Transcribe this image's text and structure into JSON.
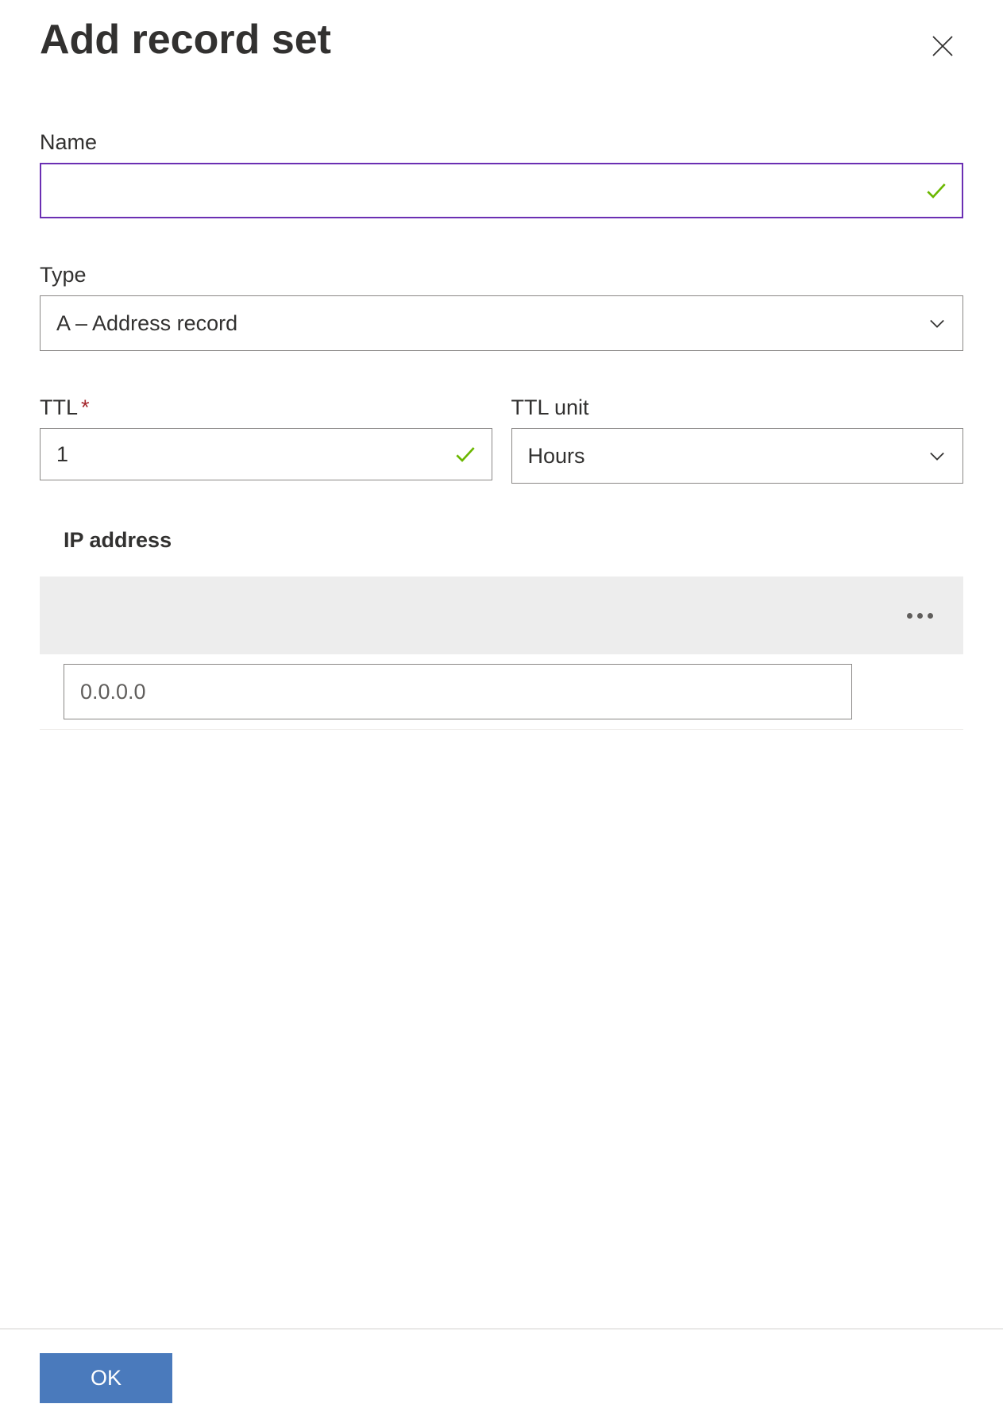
{
  "header": {
    "title": "Add record set"
  },
  "form": {
    "name": {
      "label": "Name",
      "value": ""
    },
    "type": {
      "label": "Type",
      "selected": "A – Address record"
    },
    "ttl": {
      "label": "TTL",
      "value": "1"
    },
    "ttl_unit": {
      "label": "TTL unit",
      "selected": "Hours"
    },
    "ip_address": {
      "header": "IP address",
      "placeholder": "0.0.0.0",
      "value": ""
    }
  },
  "footer": {
    "ok_label": "OK"
  }
}
